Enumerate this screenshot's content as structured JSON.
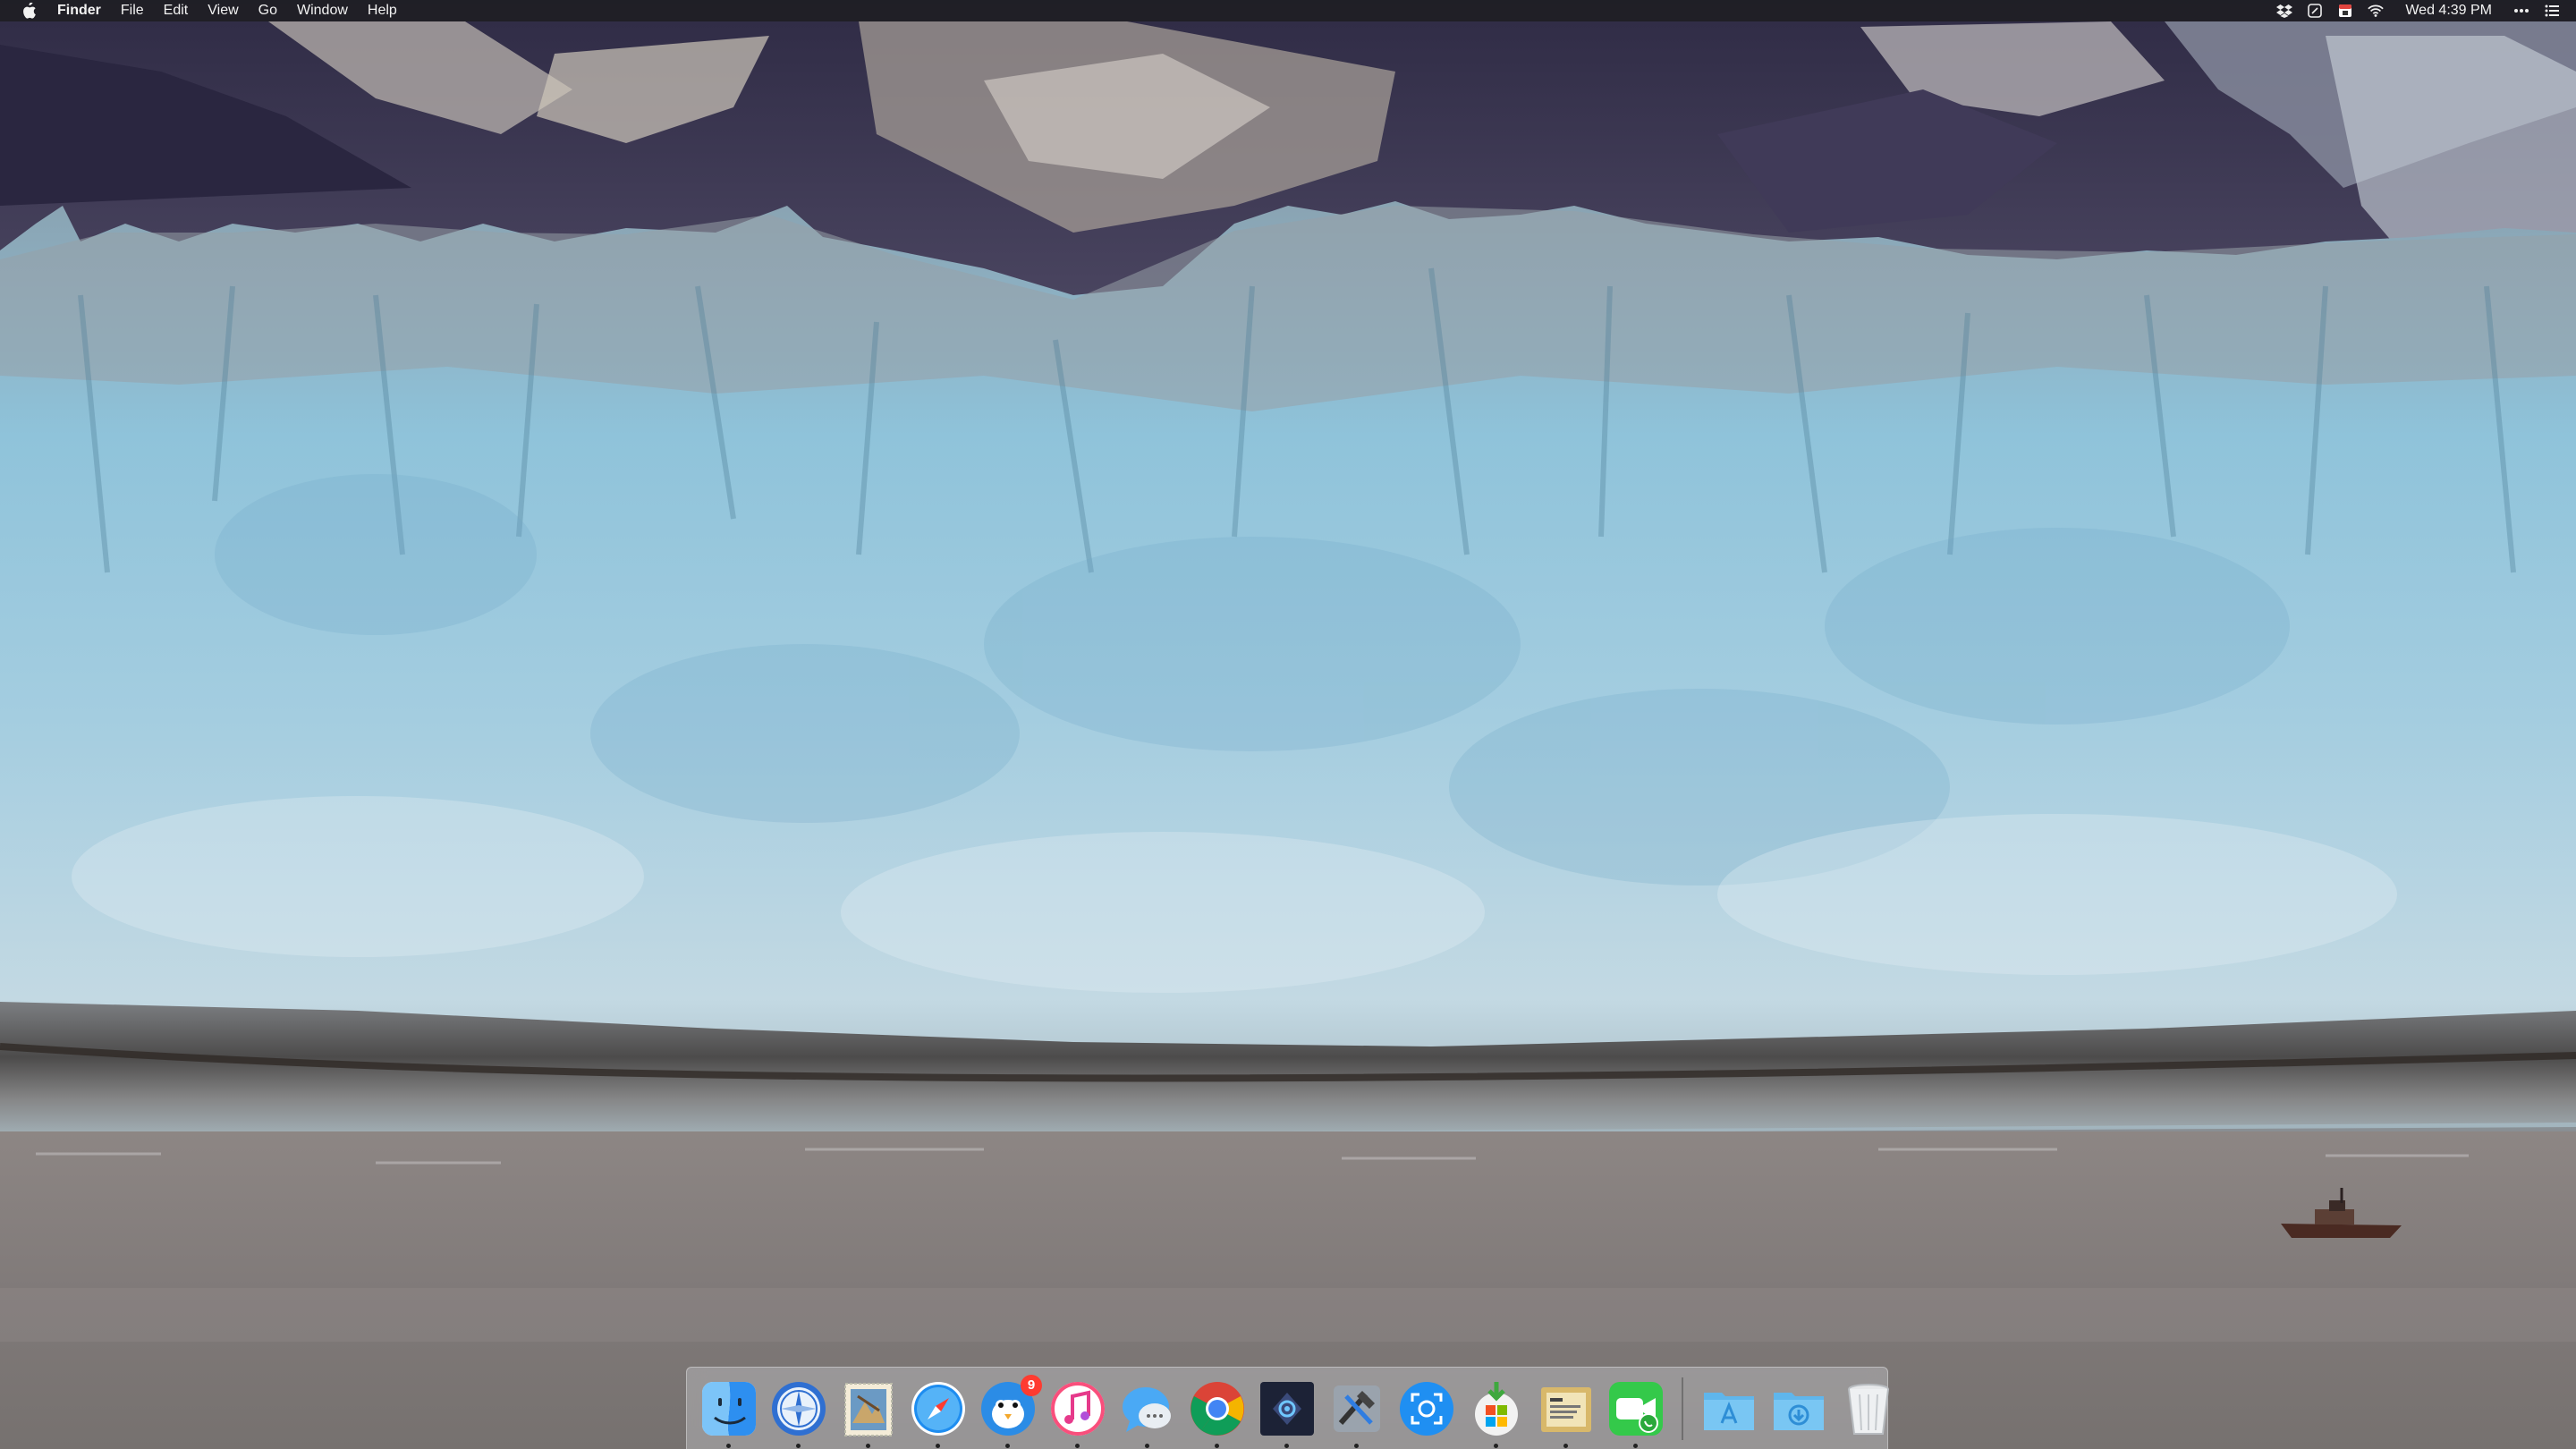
{
  "menubar": {
    "app_name": "Finder",
    "menus": [
      "File",
      "Edit",
      "View",
      "Go",
      "Window",
      "Help"
    ],
    "clock": "Wed 4:39 PM",
    "status_icons": [
      "dropbox-icon",
      "notes-icon",
      "calendar-icon",
      "wifi-icon",
      "more-icon",
      "notification-center-icon"
    ]
  },
  "dock": {
    "apps": [
      {
        "name": "finder",
        "icon": "finder-icon",
        "running": true
      },
      {
        "name": "network-radar",
        "icon": "compass-radar-icon",
        "running": true
      },
      {
        "name": "mail",
        "icon": "mail-stamp-icon",
        "running": true
      },
      {
        "name": "safari",
        "icon": "safari-compass-icon",
        "running": true
      },
      {
        "name": "tweetbot",
        "icon": "bird-icon",
        "running": true,
        "badge": "9"
      },
      {
        "name": "itunes",
        "icon": "music-note-icon",
        "running": true
      },
      {
        "name": "messages",
        "icon": "chat-bubble-icon",
        "running": true
      },
      {
        "name": "chrome",
        "icon": "chrome-icon",
        "running": true
      },
      {
        "name": "pixelmator",
        "icon": "pixelmator-icon",
        "running": true
      },
      {
        "name": "xcode-tools",
        "icon": "hammer-tools-icon",
        "running": true
      },
      {
        "name": "screenshot",
        "icon": "screenshot-icon",
        "running": false
      },
      {
        "name": "office-installer",
        "icon": "office-download-icon",
        "running": true
      },
      {
        "name": "todo",
        "icon": "todo-card-icon",
        "running": true
      },
      {
        "name": "facetime",
        "icon": "facetime-icon",
        "running": true
      }
    ],
    "stacks": [
      {
        "name": "applications",
        "icon": "applications-folder-icon"
      },
      {
        "name": "downloads",
        "icon": "downloads-folder-icon"
      },
      {
        "name": "trash",
        "icon": "trash-icon"
      }
    ]
  },
  "colors": {
    "menubar_bg": "#1e1e22",
    "badge_red": "#ff3b30",
    "glacier_blue": "#9dc3d6"
  }
}
